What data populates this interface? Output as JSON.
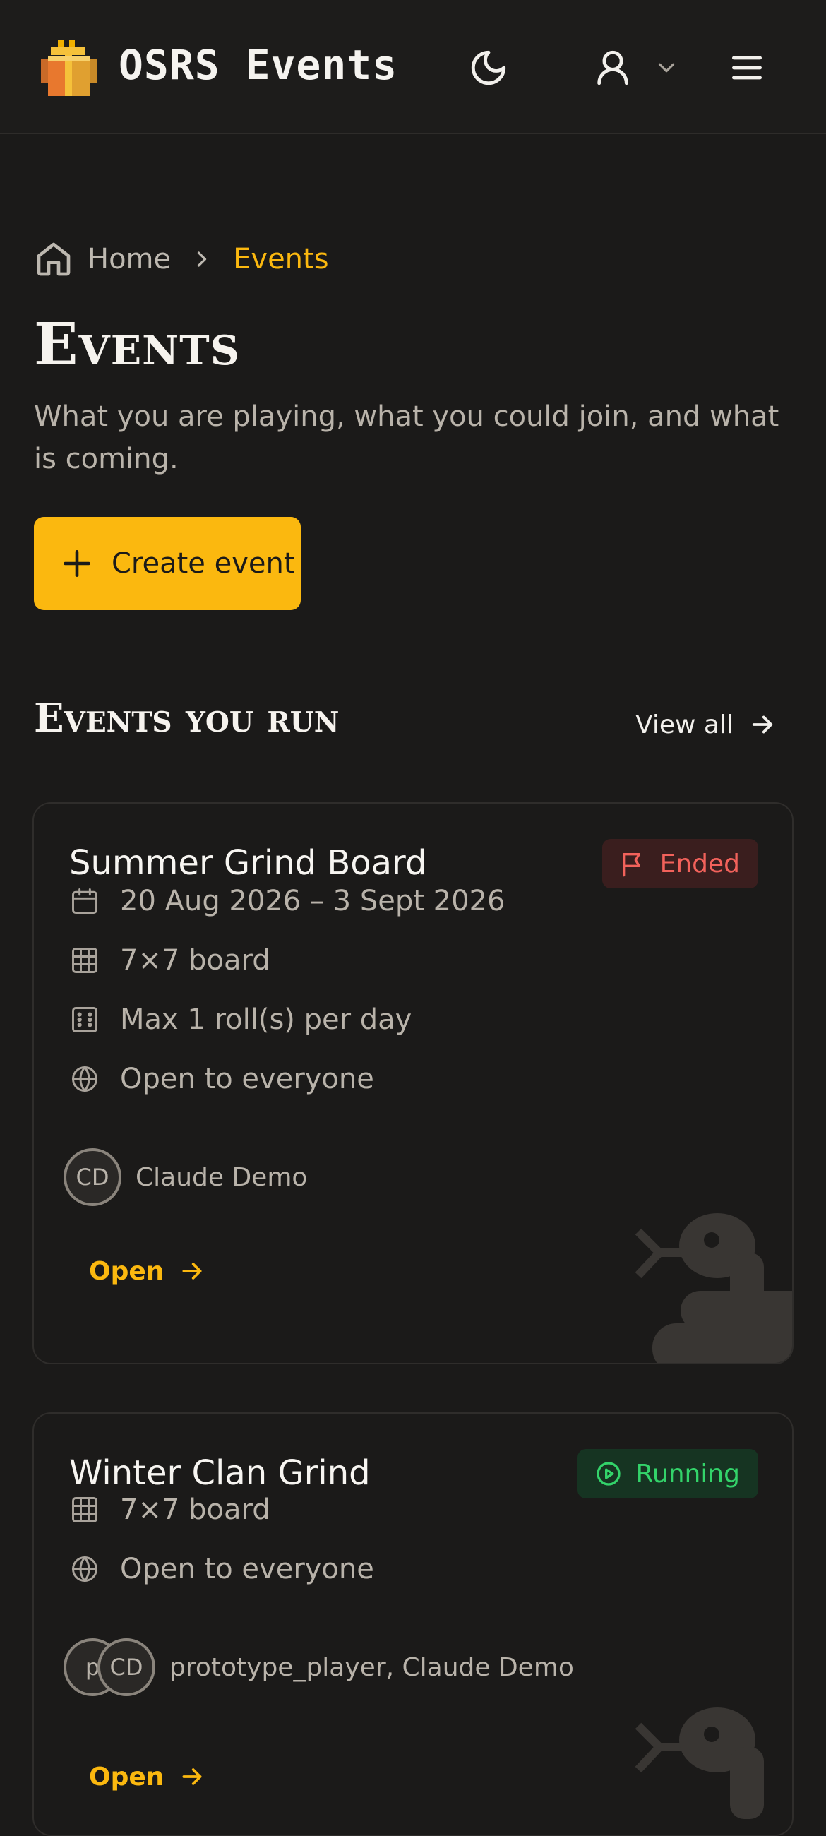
{
  "header": {
    "app_title": "OSRS Events",
    "logo_icon": "gift-box-logo-icon",
    "theme_icon": "moon-icon",
    "user_icon": "user-icon",
    "menu_icon": "hamburger-menu-icon"
  },
  "breadcrumb": {
    "home": "Home",
    "current": "Events"
  },
  "page": {
    "title": "Events",
    "subtitle": "What you are playing, what you could join, and what is coming.",
    "create_button": "Create event"
  },
  "section": {
    "title": "Events you run",
    "view_all": "View all"
  },
  "cards": [
    {
      "title": "Summer Grind Board",
      "status": "Ended",
      "dates": "20 Aug 2026 – 3 Sept 2026",
      "board": "7×7 board",
      "rolls": "Max 1 roll(s) per day",
      "visibility": "Open to everyone",
      "avatars": [
        "CD"
      ],
      "owners": "Claude Demo",
      "open": "Open"
    },
    {
      "title": "Winter Clan Grind",
      "status": "Running",
      "board": "7×7 board",
      "visibility": "Open to everyone",
      "avatars": [
        "p",
        "CD"
      ],
      "owners": "prototype_player, Claude Demo",
      "open": "Open"
    }
  ],
  "colors": {
    "accent": "#fbb80f",
    "background": "#1b1a19",
    "ended": "#f2625b",
    "running": "#33d36a"
  }
}
